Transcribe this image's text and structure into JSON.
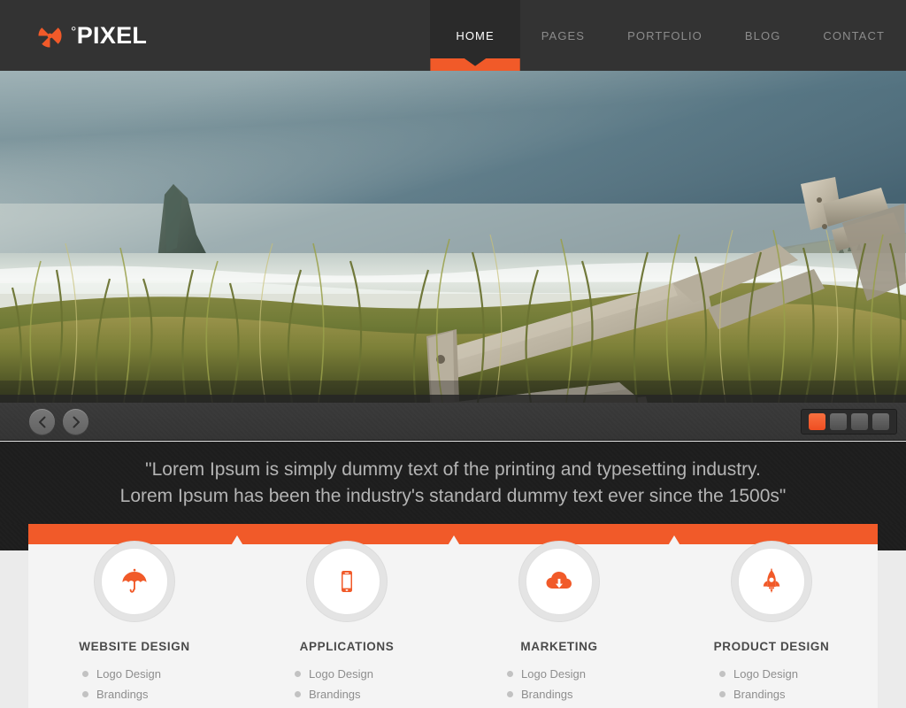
{
  "brand": {
    "logo_icon": "radiation-pinwheel-icon",
    "degree": "°",
    "name": "PIXEL",
    "accent_color": "#f15a29"
  },
  "nav": {
    "items": [
      {
        "label": "HOME",
        "active": true
      },
      {
        "label": "PAGES",
        "active": false
      },
      {
        "label": "PORTFOLIO",
        "active": false
      },
      {
        "label": "BLOG",
        "active": false
      },
      {
        "label": "CONTACT",
        "active": false
      }
    ]
  },
  "hero": {
    "alt": "coastal dune landscape with weathered wooden bench, sea stack and ocean"
  },
  "slider": {
    "prev_icon": "chevron-left-icon",
    "next_icon": "chevron-right-icon",
    "dots": [
      {
        "index": 1,
        "active": true
      },
      {
        "index": 2,
        "active": false
      },
      {
        "index": 3,
        "active": false
      },
      {
        "index": 4,
        "active": false
      }
    ]
  },
  "tagline": {
    "text": "\"Lorem Ipsum is simply dummy text of the printing and typesetting industry. Lorem Ipsum has been the industry's standard dummy text ever since the 1500s\""
  },
  "services": [
    {
      "icon": "umbrella-icon",
      "title": "WEBSITE DESIGN",
      "items": [
        "Logo Design",
        "Brandings"
      ]
    },
    {
      "icon": "mobile-phone-icon",
      "title": "APPLICATIONS",
      "items": [
        "Logo Design",
        "Brandings"
      ]
    },
    {
      "icon": "cloud-download-icon",
      "title": "MARKETING",
      "items": [
        "Logo Design",
        "Brandings"
      ]
    },
    {
      "icon": "rocket-icon",
      "title": "PRODUCT DESIGN",
      "items": [
        "Logo Design",
        "Brandings"
      ]
    }
  ]
}
